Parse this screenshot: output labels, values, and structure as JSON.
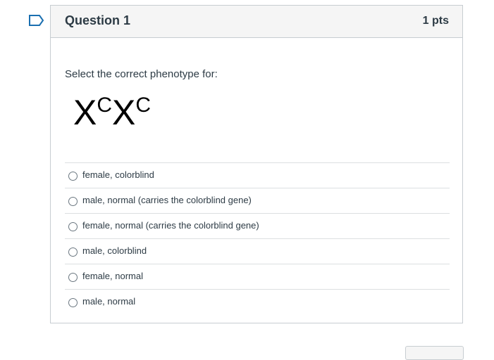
{
  "question": {
    "title": "Question 1",
    "points": "1 pts",
    "prompt": "Select the correct phenotype for:",
    "genotype": {
      "allele1_base": "X",
      "allele1_sup": "C",
      "allele2_base": "X",
      "allele2_sup": "C"
    },
    "answers": [
      {
        "label": "female, colorblind"
      },
      {
        "label": "male, normal (carries the colorblind gene)"
      },
      {
        "label": "female, normal (carries the colorblind gene)"
      },
      {
        "label": "male, colorblind"
      },
      {
        "label": "female, normal"
      },
      {
        "label": "male, normal"
      }
    ]
  },
  "icons": {
    "flag": "flag-outline-icon"
  },
  "colors": {
    "flag": "#1a6fb0",
    "header_bg": "#f5f5f5",
    "border": "#c7cdd1",
    "text": "#2d3b45"
  }
}
